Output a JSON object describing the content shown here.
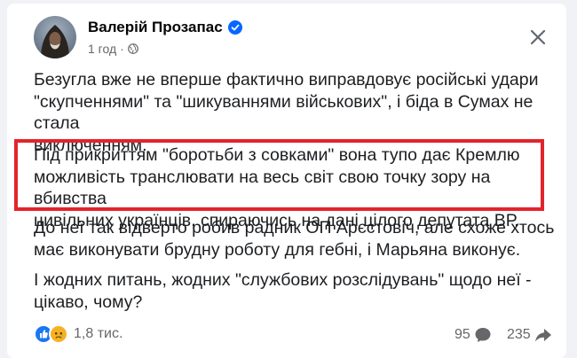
{
  "post": {
    "author": "Валерій Прозапас",
    "time": "1 год",
    "separator": "·",
    "paragraphs": [
      "Безугла вже не вперше фактично виправдовує російські удари\n\"скупченнями\" та \"шикуваннями військових\", і біда в Сумах не стала\nвиключенням.",
      "Під прикриттям \"боротьби з совками\" вона тупо дає Кремлю\nможливість транслювати на весь світ свою точку зору на вбивства\nцивільних українців, спираючись на дані цілого депутата ВР.",
      "До неї так відверто робив радник ОП Арєстовіч, але схоже хтось\nмає виконувати брудну роботу для гебні, і Марьяна виконує.",
      "І жодних питань, жодних \"службових розслідувань\" щодо неї -\nцікаво, чому?"
    ]
  },
  "footer": {
    "reactions_count": "1,8 тис.",
    "comments_count": "95",
    "shares_count": "235"
  },
  "colors": {
    "highlight": "#e3232c",
    "verified": "#0866ff",
    "like": "#1877f2",
    "sad": "#f7b125"
  },
  "icons": [
    "verified-badge-icon",
    "globe-icon",
    "close-icon",
    "like-reaction-icon",
    "sad-reaction-icon",
    "comment-icon",
    "share-icon"
  ]
}
